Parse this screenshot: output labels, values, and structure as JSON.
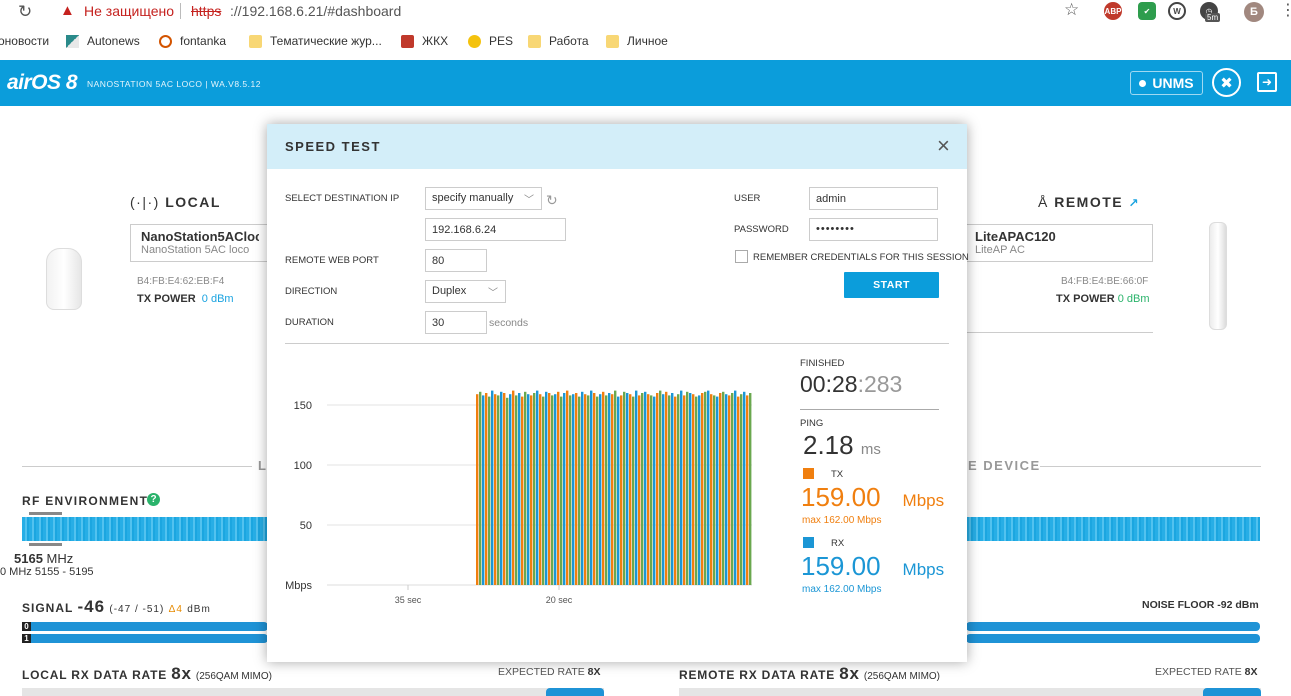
{
  "browser": {
    "security_text": "Не защищено",
    "url_scheme": "https",
    "url_rest": "://192.168.6.21/#dashboard",
    "ext_abp": "ABP",
    "ext_timer_badge": "5m",
    "avatar_letter": "Б"
  },
  "bookmarks": [
    {
      "label": "оновости"
    },
    {
      "label": "Autonews"
    },
    {
      "label": "fontanka"
    },
    {
      "label": "Тематические жур..."
    },
    {
      "label": "ЖКХ"
    },
    {
      "label": "PES"
    },
    {
      "label": "Работа"
    },
    {
      "label": "Личное"
    }
  ],
  "header": {
    "logo": "airOS 8",
    "device_info": "NANOSTATION 5AC LOCO | WA.V8.5.12",
    "unms_label": "UNMS"
  },
  "local": {
    "label": "LOCAL",
    "name": "NanoStation5ACloco",
    "model": "NanoStation 5AC loco",
    "mac": "B4:FB:E4:62:EB:F4",
    "tx_power_label": "TX POWER",
    "tx_power_value": "0 dBm"
  },
  "remote": {
    "label": "REMOTE",
    "name": "LiteAPAC120",
    "model": "LiteAP AC",
    "mac": "B4:FB:E4:BE:66:0F",
    "tx_power_label": "TX POWER",
    "tx_power_value": "0 dBm"
  },
  "dashboard": {
    "section_left_frag": "L",
    "section_right_frag": "E DEVICE",
    "rf_title": "RF ENVIRONMENT",
    "freq_main": "5165",
    "freq_unit": "MHz",
    "freq_range": "0 MHz 5155 - 5195",
    "signal_label": "SIGNAL",
    "signal_value": "-46",
    "signal_chains": "(-47 / -51)",
    "signal_delta": "Δ4",
    "signal_unit": "dBm",
    "noise_floor": "NOISE FLOOR -92 dBm",
    "chain0": "0",
    "chain1": "1",
    "local_rx_label": "LOCAL RX DATA RATE",
    "local_rx_value": "8x",
    "local_rx_mod": "(256QAM MIMO)",
    "remote_rx_label": "REMOTE RX DATA RATE",
    "remote_rx_value": "8x",
    "remote_rx_mod": "(256QAM MIMO)",
    "expected_label": "EXPECTED RATE",
    "expected_value": "8X"
  },
  "modal": {
    "title": "SPEED TEST",
    "close_symbol": "×",
    "dest_label": "SELECT DESTINATION IP",
    "dest_mode": "specify manually",
    "dest_ip": "192.168.6.24",
    "port_label": "REMOTE WEB PORT",
    "port_value": "80",
    "direction_label": "DIRECTION",
    "direction_value": "Duplex",
    "duration_label": "DURATION",
    "duration_value": "30",
    "duration_unit": "seconds",
    "user_label": "USER",
    "user_value": "admin",
    "password_label": "PASSWORD",
    "password_value": "••••••••",
    "remember_label": "REMEMBER CREDENTIALS FOR THIS SESSION",
    "start_label": "START"
  },
  "results": {
    "status": "FINISHED",
    "timer_main": "00:28",
    "timer_ms": ":283",
    "ping_label": "PING",
    "ping_value": "2.18",
    "ping_unit": "ms",
    "tx_label": "TX",
    "tx_value": "159.00",
    "tx_unit": "Mbps",
    "tx_max": "max 162.00 Mbps",
    "rx_label": "RX",
    "rx_value": "159.00",
    "rx_unit": "Mbps",
    "rx_max": "max 162.00 Mbps"
  },
  "colors": {
    "brand_blue": "#0b9ddb",
    "tx_orange": "#f07f0f",
    "rx_blue": "#1b96d5",
    "chart_green": "#6aa84f"
  },
  "chart_data": {
    "type": "bar",
    "ylabel": "Mbps",
    "y_ticks": [
      150,
      100,
      50
    ],
    "ylim": [
      0,
      180
    ],
    "x_ticks": [
      "35 sec",
      "20 sec"
    ],
    "series": [
      {
        "name": "TX",
        "color": "#f07f0f"
      },
      {
        "name": "RX",
        "color": "#1b96d5"
      }
    ],
    "samples": [
      159,
      161,
      158,
      160,
      157,
      162,
      159,
      158,
      161,
      160,
      156,
      159,
      162,
      158,
      160,
      157,
      161,
      159,
      158,
      160,
      162,
      159,
      157,
      161,
      160,
      158,
      159,
      161,
      157,
      160,
      162,
      158,
      159,
      160,
      157,
      161,
      159,
      158,
      162,
      160,
      157,
      159,
      161,
      158,
      160,
      159,
      162,
      157,
      158,
      161,
      160,
      159,
      157,
      162,
      158,
      160,
      161,
      159,
      158,
      157,
      160,
      162,
      159,
      161,
      158,
      160,
      157,
      159,
      162,
      158,
      161,
      160,
      159,
      157,
      158,
      160,
      161,
      162,
      159,
      158,
      157,
      160,
      161,
      159,
      158,
      160,
      162,
      157,
      159,
      161,
      158,
      160
    ]
  }
}
